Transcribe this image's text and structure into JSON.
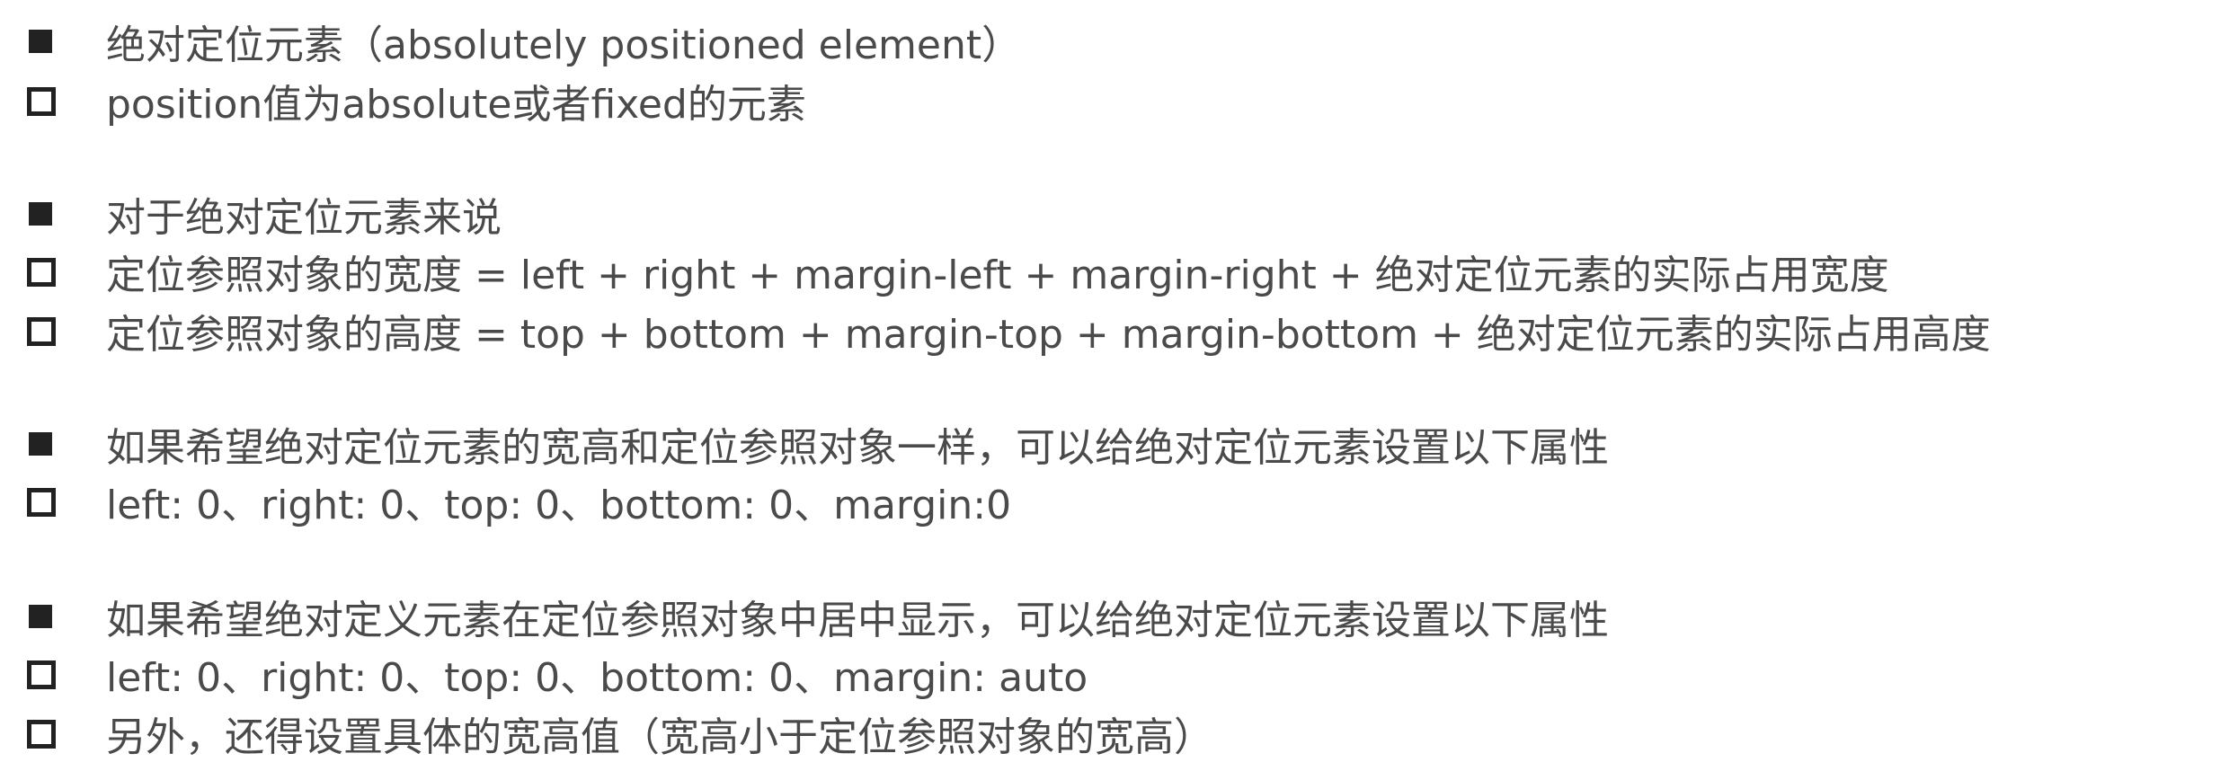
{
  "sections": [
    {
      "heading": "绝对定位元素（absolutely positioned element）",
      "items": [
        "position值为absolute或者fixed的元素"
      ]
    },
    {
      "heading": "对于绝对定位元素来说",
      "items": [
        "定位参照对象的宽度 = left + right + margin-left + margin-right + 绝对定位元素的实际占用宽度",
        "定位参照对象的高度 = top + bottom + margin-top + margin-bottom + 绝对定位元素的实际占用高度"
      ]
    },
    {
      "heading": "如果希望绝对定位元素的宽高和定位参照对象一样，可以给绝对定位元素设置以下属性",
      "items": [
        "left: 0、right: 0、top: 0、bottom: 0、margin:0"
      ]
    },
    {
      "heading": "如果希望绝对定义元素在定位参照对象中居中显示，可以给绝对定位元素设置以下属性",
      "items": [
        "left: 0、right: 0、top: 0、bottom: 0、margin: auto",
        "另外，还得设置具体的宽高值（宽高小于定位参照对象的宽高）"
      ]
    }
  ],
  "colors": {
    "text": "#4a4a4a",
    "bullet": "#222222",
    "background": "#ffffff"
  }
}
